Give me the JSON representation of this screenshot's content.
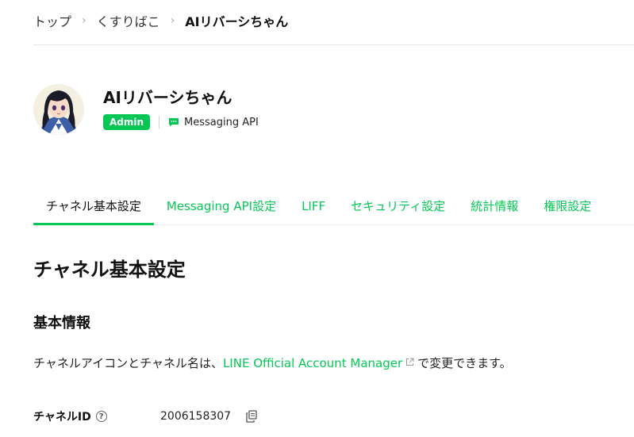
{
  "breadcrumb": {
    "items": [
      "トップ",
      "くすりばこ",
      "AIリバーシちゃん"
    ],
    "separator": "›"
  },
  "channel": {
    "name": "AIリバーシちゃん",
    "role_badge": "Admin",
    "type_label": "Messaging API",
    "avatar": "avatar-image"
  },
  "tabs": [
    {
      "label": "チャネル基本設定",
      "active": true
    },
    {
      "label": "Messaging API設定",
      "active": false
    },
    {
      "label": "LIFF",
      "active": false
    },
    {
      "label": "セキュリティ設定",
      "active": false
    },
    {
      "label": "統計情報",
      "active": false
    },
    {
      "label": "権限設定",
      "active": false
    }
  ],
  "main": {
    "page_title": "チャネル基本設定",
    "section_title": "基本情報",
    "description_prefix": "チャネルアイコンとチャネル名は、",
    "description_link": "LINE Official Account Manager",
    "description_suffix": "で変更できます。",
    "channel_id_label": "チャネルID",
    "channel_id_value": "2006158307",
    "help_glyph": "?"
  },
  "colors": {
    "accent": "#06c755",
    "text": "#111111",
    "muted": "#aaaaaa"
  },
  "icons": {
    "help": "question-circle-icon",
    "copy": "copy-icon",
    "external": "external-link-icon",
    "chat": "chat-bubble-icon"
  }
}
